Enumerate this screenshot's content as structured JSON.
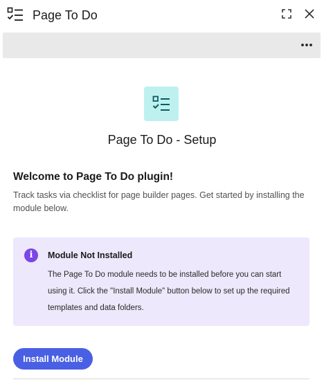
{
  "window": {
    "title": "Page To Do",
    "app_icon": "checklist-icon",
    "controls": {
      "expand_icon": "expand-icon",
      "close_icon": "close-icon"
    }
  },
  "toolbar": {
    "more_icon": "more-icon"
  },
  "setup": {
    "icon": "checklist-icon",
    "title": "Page To Do - Setup",
    "welcome_heading": "Welcome to Page To Do plugin!",
    "welcome_description": "Track tasks via checklist for page builder pages. Get started by installing the module below."
  },
  "notice": {
    "icon": "info-icon",
    "icon_glyph": "i",
    "title": "Module Not Installed",
    "body": "The Page To Do module needs to be installed before you can start using it. Click the \"Install Module\" button below to set up the required templates and data folders."
  },
  "actions": {
    "install_label": "Install Module"
  },
  "colors": {
    "accent_button": "#4a60e4",
    "notice_background": "#ede8fb",
    "notice_icon": "#7b46e6",
    "setup_icon_background": "#bff0f0",
    "setup_icon_foreground": "#0d5a5f",
    "toolbar_background": "#e9e9e9"
  }
}
